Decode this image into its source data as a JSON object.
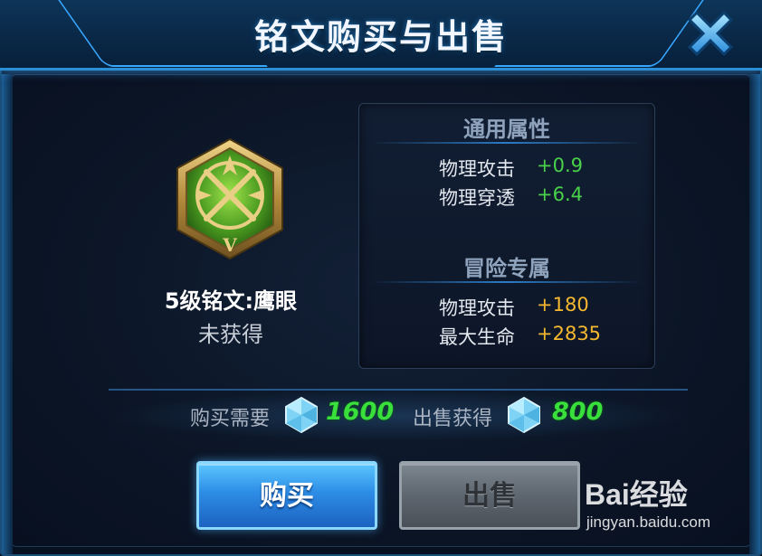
{
  "dialog": {
    "title": "铭文购买与出售",
    "close_icon": "close-x-icon"
  },
  "rune": {
    "icon": "rune-hawkeye-icon",
    "name": "5级铭文:鹰眼",
    "status": "未获得",
    "level_mark": "V"
  },
  "attributes": {
    "general": {
      "heading": "通用属性",
      "rows": [
        {
          "label": "物理攻击",
          "value": "+0.9"
        },
        {
          "label": "物理穿透",
          "value": "+6.4"
        }
      ]
    },
    "adventure": {
      "heading": "冒险专属",
      "rows": [
        {
          "label": "物理攻击",
          "value": "+180"
        },
        {
          "label": "最大生命",
          "value": "+2835"
        }
      ]
    }
  },
  "pricing": {
    "buy_label": "购买需要",
    "buy_cost": "1600",
    "sell_label": "出售获得",
    "sell_gain": "800",
    "currency_icon": "crystal-icon"
  },
  "buttons": {
    "buy": "购买",
    "sell": "出售"
  },
  "watermark": {
    "logo": "Bai经验",
    "site": "jingyan.baidu.com"
  },
  "colors": {
    "accent": "#2b8fd6",
    "positive": "#4ad14a",
    "gold": "#f5b82e",
    "price": "#39e03b"
  }
}
